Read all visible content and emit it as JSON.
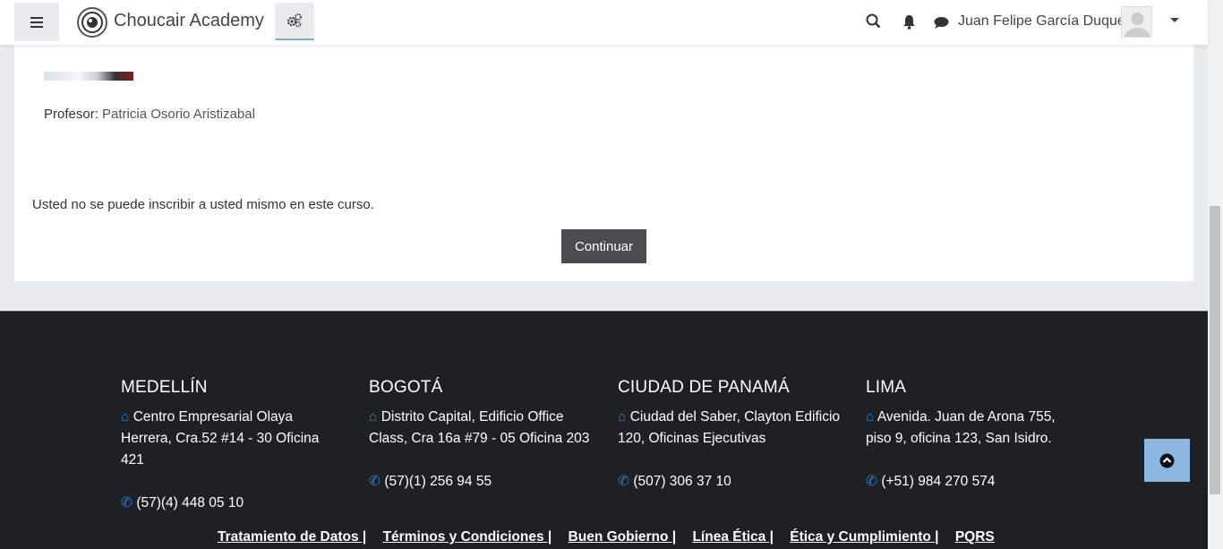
{
  "header": {
    "brand": "Choucair Academy",
    "username": "Juan Felipe García Duque",
    "icons": [
      "menu-icon",
      "logo-icon",
      "settings-icon",
      "search-icon",
      "bell-icon",
      "chat-icon",
      "avatar",
      "caret-down-icon"
    ]
  },
  "course": {
    "teacher_label": "Profesor: ",
    "teacher_name": "Patricia Osorio Aristizabal",
    "notice": "Usted no se puede inscribir a usted mismo en este curso.",
    "continue_label": "Continuar"
  },
  "footer": {
    "offices": [
      {
        "city": "MEDELLÍN",
        "address": "Centro Empresarial Olaya Herrera, Cra.52 #14 - 30 Oficina 421",
        "phone": "(57)(4) 448 05 10"
      },
      {
        "city": "BOGOTÁ",
        "address": "Distrito Capital, Edificio Office Class, Cra 16a #79 - 05 Oficina 203",
        "phone": "(57)(1) 256 94 55"
      },
      {
        "city": "CIUDAD DE PANAMÁ",
        "address": "Ciudad del Saber, Clayton Edificio 120, Oficinas Ejecutivas",
        "phone": "(507) 306 37 10"
      },
      {
        "city": "LIMA",
        "address": "Avenida. Juan de Arona 755, piso 9, oficina 123, San Isidro.",
        "phone": "(+51) 984 270 574"
      }
    ],
    "links": [
      "Tratamiento de Datos |",
      "Términos y Condiciones |",
      "Buen Gobierno |",
      "Línea Ética |",
      "Ética y Cumplimiento |",
      "PQRS"
    ]
  },
  "colors": {
    "accent": "#2f80d1",
    "footer_bg": "#1d2125",
    "button_bg": "#4a4c50",
    "back_to_top": "#8db7e0"
  }
}
